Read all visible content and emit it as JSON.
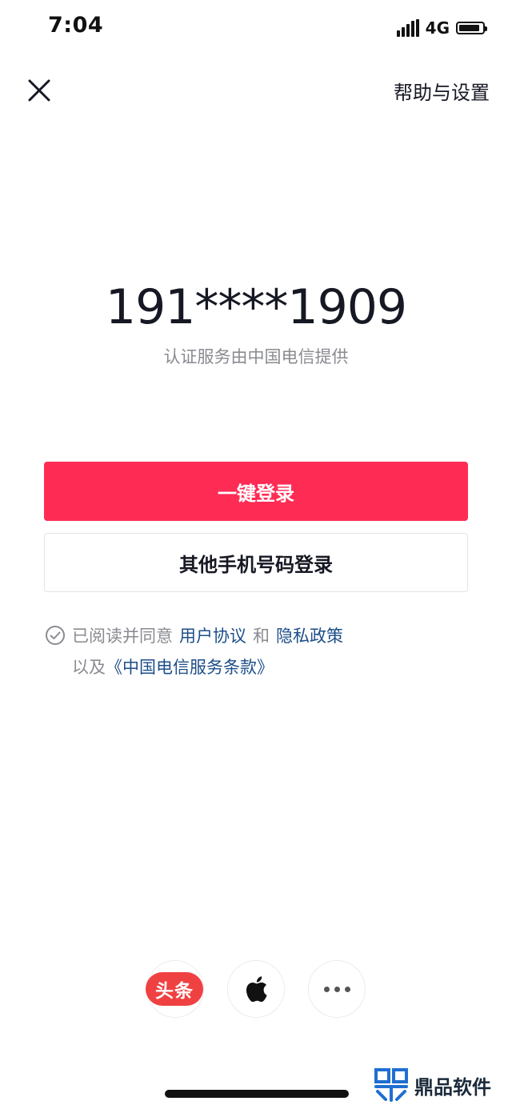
{
  "status_bar": {
    "time": "7:04",
    "network": "4G",
    "battery_level": 0.9
  },
  "header": {
    "close_icon": "close-icon",
    "help_label": "帮助与设置"
  },
  "phone": {
    "masked_number": "191****1909",
    "auth_provider": "认证服务由中国电信提供"
  },
  "actions": {
    "one_click_login": "一键登录",
    "other_phone_login": "其他手机号码登录"
  },
  "agreement": {
    "prefix": "已阅读并同意",
    "user_agreement": "用户协议",
    "and": "和",
    "privacy_policy": "隐私政策",
    "also": "以及",
    "carrier_terms": "《中国电信服务条款》"
  },
  "third_party": {
    "toutiao_label": "头条",
    "apple_icon": "apple-icon",
    "more_icon": "more-icon"
  },
  "watermark": {
    "text": "鼎品软件"
  },
  "colors": {
    "primary": "#fe2c55",
    "link": "#1d4e89",
    "toutiao": "#f04142",
    "watermark_logo": "#1f6fd1"
  }
}
